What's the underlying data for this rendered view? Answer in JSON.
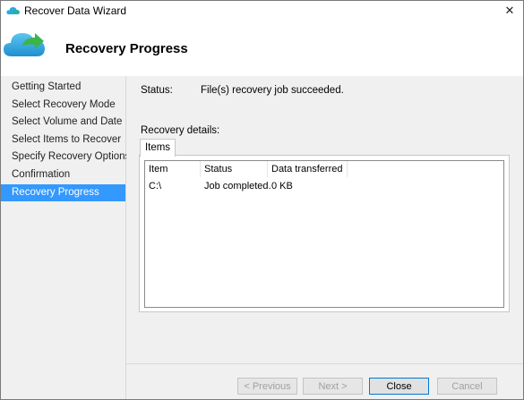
{
  "window": {
    "title": "Recover Data Wizard",
    "close_glyph": "✕"
  },
  "header": {
    "title": "Recovery Progress",
    "icon": "cloud-recovery-icon"
  },
  "sidebar": {
    "items": [
      {
        "label": "Getting Started",
        "active": false
      },
      {
        "label": "Select Recovery Mode",
        "active": false
      },
      {
        "label": "Select Volume and Date",
        "active": false
      },
      {
        "label": "Select Items to Recover",
        "active": false
      },
      {
        "label": "Specify Recovery Options",
        "active": false
      },
      {
        "label": "Confirmation",
        "active": false
      },
      {
        "label": "Recovery Progress",
        "active": true
      }
    ]
  },
  "main": {
    "status_label": "Status:",
    "status_value": "File(s) recovery job succeeded.",
    "details_label": "Recovery details:",
    "tab_label": "Items",
    "columns": [
      "Item",
      "Status",
      "Data transferred"
    ],
    "rows": [
      {
        "item": "C:\\",
        "status": "Job completed.",
        "data": "0 KB"
      }
    ]
  },
  "footer": {
    "previous": "< Previous",
    "next": "Next >",
    "close": "Close",
    "cancel": "Cancel"
  },
  "colors": {
    "selection": "#3399ff",
    "accent_border": "#0078d7",
    "cloud": "#29a9e0",
    "arrow": "#3cb44a"
  }
}
